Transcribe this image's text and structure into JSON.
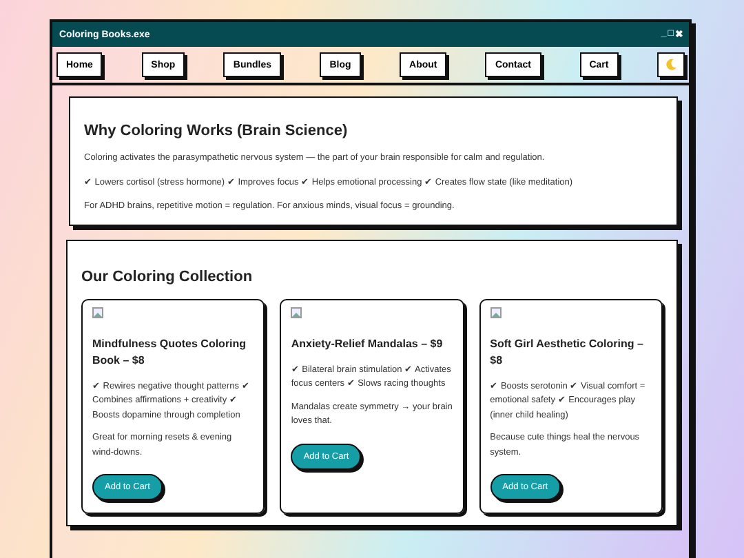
{
  "window": {
    "title": "Coloring Books.exe",
    "controls": [
      "_",
      "□",
      "✖"
    ]
  },
  "nav": [
    {
      "label": "Home"
    },
    {
      "label": "Shop"
    },
    {
      "label": "Bundles"
    },
    {
      "label": "Blog"
    },
    {
      "label": "About"
    },
    {
      "label": "Contact"
    },
    {
      "label": "Cart"
    }
  ],
  "science": {
    "heading": "Why Coloring Works (Brain Science)",
    "paragraphs": [
      "Coloring activates the parasympathetic nervous system — the part of your brain responsible for calm and regulation.",
      "✔ Lowers cortisol (stress hormone) ✔ Improves focus ✔ Helps emotional processing ✔ Creates flow state (like meditation)",
      "For ADHD brains, repetitive motion = regulation. For anxious minds, visual focus = grounding."
    ]
  },
  "collection": {
    "heading": "Our Coloring Collection",
    "products": [
      {
        "title": "Mindfulness Quotes Coloring Book – $8",
        "benefits": "✔ Rewires negative thought patterns ✔ Combines affirmations + creativity ✔ Boosts dopamine through completion",
        "note": "Great for morning resets & evening wind-downs.",
        "button": "Add to Cart"
      },
      {
        "title": "Anxiety-Relief Mandalas – $9",
        "benefits": "✔ Bilateral brain stimulation ✔ Activates focus centers ✔ Slows racing thoughts",
        "note": "Mandalas create symmetry → your brain loves that.",
        "button": "Add to Cart"
      },
      {
        "title": "Soft Girl Aesthetic Coloring – $8",
        "benefits": "✔ Boosts serotonin ✔ Visual comfort = emotional safety ✔ Encourages play (inner child healing)",
        "note": "Because cute things heal the nervous system.",
        "button": "Add to Cart"
      }
    ]
  }
}
